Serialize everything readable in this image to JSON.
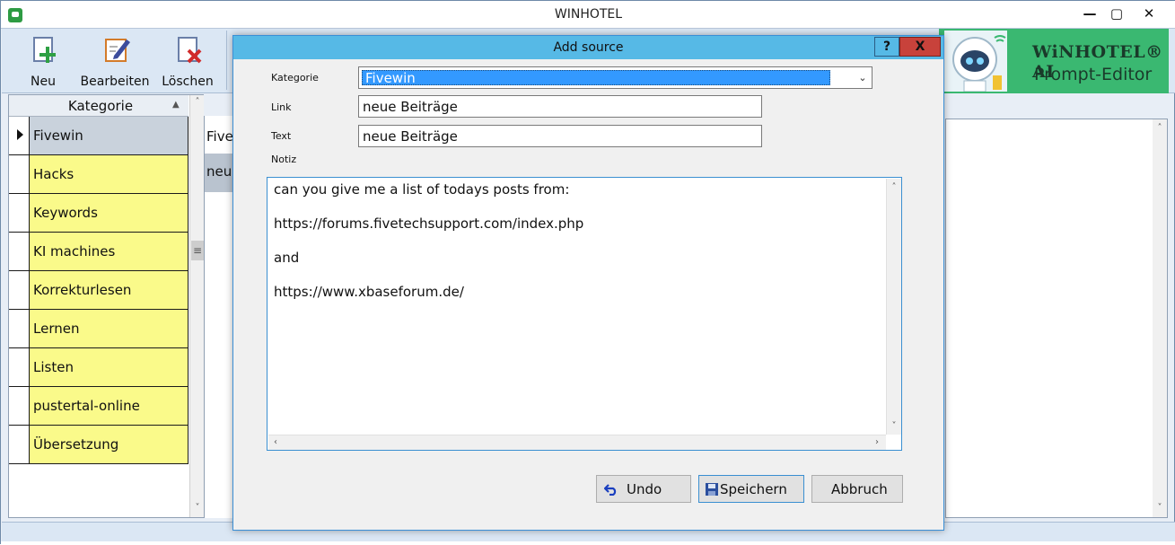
{
  "window": {
    "title": "WINHOTEL",
    "minimize": "—",
    "maximize": "▢",
    "close": "✕"
  },
  "toolbar": {
    "new_label": "Neu",
    "edit_label": "Bearbeiten",
    "delete_label": "Löschen"
  },
  "banner": {
    "brand": "WiNHOTEL® AI",
    "subtitle": "Prompt-Editor"
  },
  "category_list": {
    "header": "Kategorie",
    "sort_glyph": "▲",
    "selected_index": 0,
    "items": [
      "Fivewin",
      "Hacks",
      "Keywords",
      "KI machines",
      "Korrekturlesen",
      "Lernen",
      "Listen",
      "pustertal-online",
      "Übersetzung"
    ]
  },
  "middle_grid": {
    "row1": "Fivewin",
    "row2": "neue Beiträge"
  },
  "dialog": {
    "title": "Add source",
    "help": "?",
    "close": "X",
    "category_label": "Kategorie",
    "category_value": "Fivewin",
    "link_label": "Link",
    "link_value": "neue Beiträge",
    "text_label": "Text",
    "text_value": "neue Beiträge",
    "notes_label": "Notiz",
    "notes_value": "can you give me a list of todays posts from:\n\nhttps://forums.fivetechsupport.com/index.php\n\nand\n\nhttps://www.xbaseforum.de/",
    "undo_label": "Undo",
    "save_label": "Speichern",
    "cancel_label": "Abbruch"
  },
  "colors": {
    "dialog_title": "#56b9e6",
    "category_row": "#fafa8a",
    "selected_row": "#c9d2dc",
    "close_button": "#c8423b",
    "banner": "#3ab871"
  }
}
